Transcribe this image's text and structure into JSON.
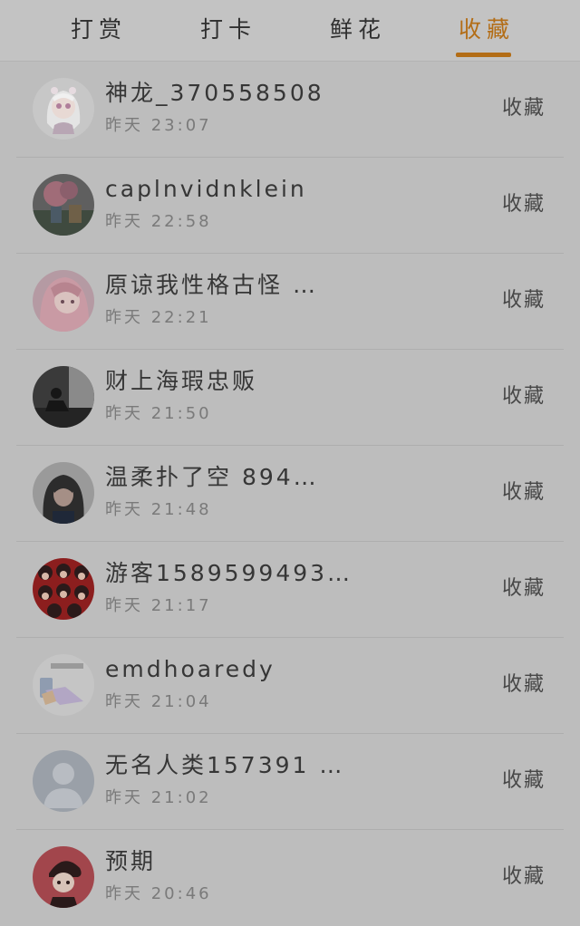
{
  "tabs": [
    {
      "label": "打赏"
    },
    {
      "label": "打卡"
    },
    {
      "label": "鲜花"
    },
    {
      "label": "收藏"
    }
  ],
  "active_tab": "收藏",
  "accent_color": "#b36d16",
  "list": [
    {
      "name": "神龙_370558508",
      "time": "昨天 23:07",
      "action": "收藏",
      "avatar": "anime-girl-white-hair"
    },
    {
      "name": "caplnvidnklein",
      "time": "昨天 22:58",
      "action": "收藏",
      "avatar": "pink-flower-photo"
    },
    {
      "name": "原谅我性格古怪 …",
      "time": "昨天 22:21",
      "action": "收藏",
      "avatar": "anime-girl-pink"
    },
    {
      "name": "财上海瑕忠贩",
      "time": "昨天 21:50",
      "action": "收藏",
      "avatar": "person-sitting-photo"
    },
    {
      "name": "温柔扑了空 894…",
      "time": "昨天 21:48",
      "action": "收藏",
      "avatar": "dark-hair-girl-photo"
    },
    {
      "name": "游客1589599493…",
      "time": "昨天 21:17",
      "action": "收藏",
      "avatar": "red-cartoon-pattern"
    },
    {
      "name": "emdhoaredy",
      "time": "昨天 21:04",
      "action": "收藏",
      "avatar": "hand-phone-photo"
    },
    {
      "name": "无名人类157391 …",
      "time": "昨天 21:02",
      "action": "收藏",
      "avatar": "default-person-silhouette"
    },
    {
      "name": "预期",
      "time": "昨天 20:46",
      "action": "收藏",
      "avatar": "cartoon-boy-red"
    }
  ]
}
